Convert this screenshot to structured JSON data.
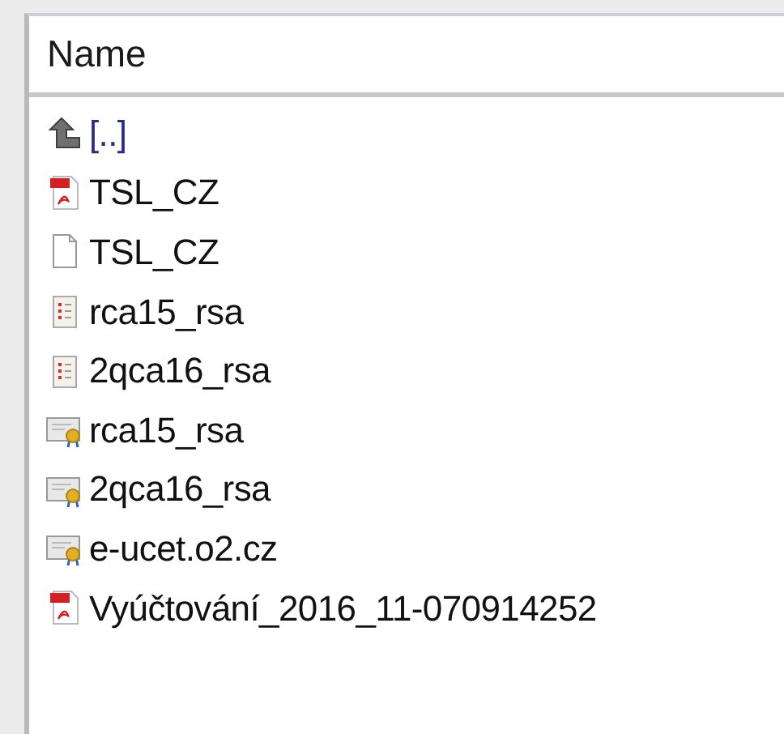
{
  "header": {
    "name_column": "Name"
  },
  "files": [
    {
      "kind": "up",
      "name": "[..]"
    },
    {
      "kind": "pdf",
      "name": "TSL_CZ"
    },
    {
      "kind": "blank",
      "name": "TSL_CZ"
    },
    {
      "kind": "list",
      "name": "rca15_rsa"
    },
    {
      "kind": "list",
      "name": "2qca16_rsa"
    },
    {
      "kind": "certificate",
      "name": "rca15_rsa"
    },
    {
      "kind": "certificate",
      "name": "2qca16_rsa"
    },
    {
      "kind": "certificate",
      "name": "e-ucet.o2.cz"
    },
    {
      "kind": "pdf",
      "name": "Vyúčtování_2016_11-070914252"
    }
  ]
}
